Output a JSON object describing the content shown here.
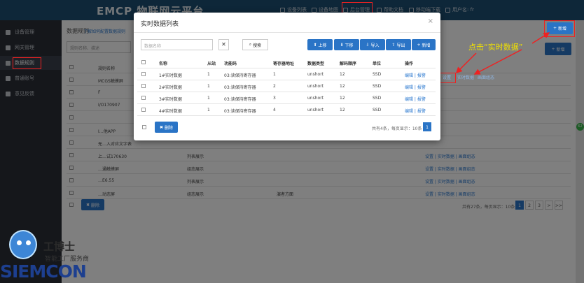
{
  "app": {
    "logo": "EMCP 物联网云平台"
  },
  "topnav": [
    {
      "label": "设备列表",
      "icon": "monitor-icon"
    },
    {
      "label": "设备地图",
      "icon": "globe-icon"
    },
    {
      "label": "后台管理",
      "icon": "gear-icon"
    },
    {
      "label": "帮助文档",
      "icon": "help-icon"
    },
    {
      "label": "移动端下载",
      "icon": "phone-icon"
    },
    {
      "label": "用户名: fr",
      "icon": "user-icon"
    }
  ],
  "sidebar": {
    "items": [
      {
        "label": "设备管理",
        "icon": "grid-icon"
      },
      {
        "label": "网关管理",
        "icon": "login-icon"
      },
      {
        "label": "数据规则",
        "icon": "doc-icon"
      },
      {
        "label": "普通账号",
        "icon": "user-icon"
      },
      {
        "label": "意见反馈",
        "icon": "edit-icon"
      }
    ]
  },
  "page": {
    "title": "数据规则",
    "link": "了解如何配置数据规则",
    "search_placeholder": "规则名称、描述",
    "add_label": "新增",
    "delete_label": "删除",
    "columns": [
      "规则名称"
    ],
    "rows": [
      {
        "name": "MCGS触摸屏",
        "col2": "",
        "col3": "",
        "ops": ""
      },
      {
        "name": "F",
        "col2": "",
        "col3": "",
        "ops": ""
      },
      {
        "name": "I/O170907",
        "col2": "",
        "col3": "",
        "ops": ""
      },
      {
        "name": "",
        "col2": "",
        "col3": "",
        "ops": ""
      },
      {
        "name": "I…他APP",
        "col2": "",
        "col3": "",
        "ops": ""
      },
      {
        "name": "无…入对应文字表",
        "col2": "",
        "col3": "",
        "ops": ""
      },
      {
        "name": "上…试170630",
        "col2": "列表展示",
        "col3": "",
        "ops": "设置 | 实时数据 | 画面组态"
      },
      {
        "name": "…通触摸屏",
        "col2": "组态展示",
        "col3": "",
        "ops": "设置 | 实时数据 | 画面组态"
      },
      {
        "name": "…E6.55",
        "col2": "列表展示",
        "col3": "",
        "ops": "设置 | 实时数据 | 画面组态"
      },
      {
        "name": "…动态屏",
        "col2": "组态展示",
        "col3": "演者方面",
        "ops": "设置 | 实时数据 | 画面组态"
      }
    ],
    "ops_labels": [
      "设置",
      "实时数据",
      "画面组态"
    ],
    "pager_info": "共有27条，每页显示：10条",
    "pages": [
      "1",
      "2",
      "3",
      ">",
      ">>"
    ]
  },
  "modal": {
    "title": "实时数据列表",
    "close": "×",
    "search_placeholder": "数据名称",
    "clear": "✕",
    "search_label": "搜索",
    "toolbar": [
      "上移",
      "下移",
      "导入",
      "导出",
      "新增"
    ],
    "columns": [
      "名称",
      "从站",
      "功能码",
      "寄存器地址",
      "数据类型",
      "解码顺序",
      "单位",
      "操作"
    ],
    "rows": [
      {
        "name": "1#实时数据",
        "slave": "1",
        "func": "03:读保持寄存器",
        "addr": "1",
        "type": "unshort",
        "order": "12",
        "unit": "SSD",
        "ops": "编辑 | 报警"
      },
      {
        "name": "2#实时数据",
        "slave": "1",
        "func": "03:读保持寄存器",
        "addr": "2",
        "type": "unshort",
        "order": "12",
        "unit": "SSD",
        "ops": "编辑 | 报警"
      },
      {
        "name": "3#实时数据",
        "slave": "1",
        "func": "03:读保持寄存器",
        "addr": "3",
        "type": "unshort",
        "order": "12",
        "unit": "SSD",
        "ops": "编辑 | 报警"
      },
      {
        "name": "4#实时数据",
        "slave": "1",
        "func": "03:读保持寄存器",
        "addr": "4",
        "type": "unshort",
        "order": "12",
        "unit": "SSD",
        "ops": "编辑 | 报警"
      }
    ],
    "delete_label": "删除",
    "pager_info": "共有4条，每页显示：10条",
    "page": "1"
  },
  "annotation": "点击“实时数据”",
  "watermark": {
    "brand": "SIEMCON",
    "mascot_name": "工博士",
    "tagline": "智能工厂服务商"
  },
  "float_badge": "62"
}
